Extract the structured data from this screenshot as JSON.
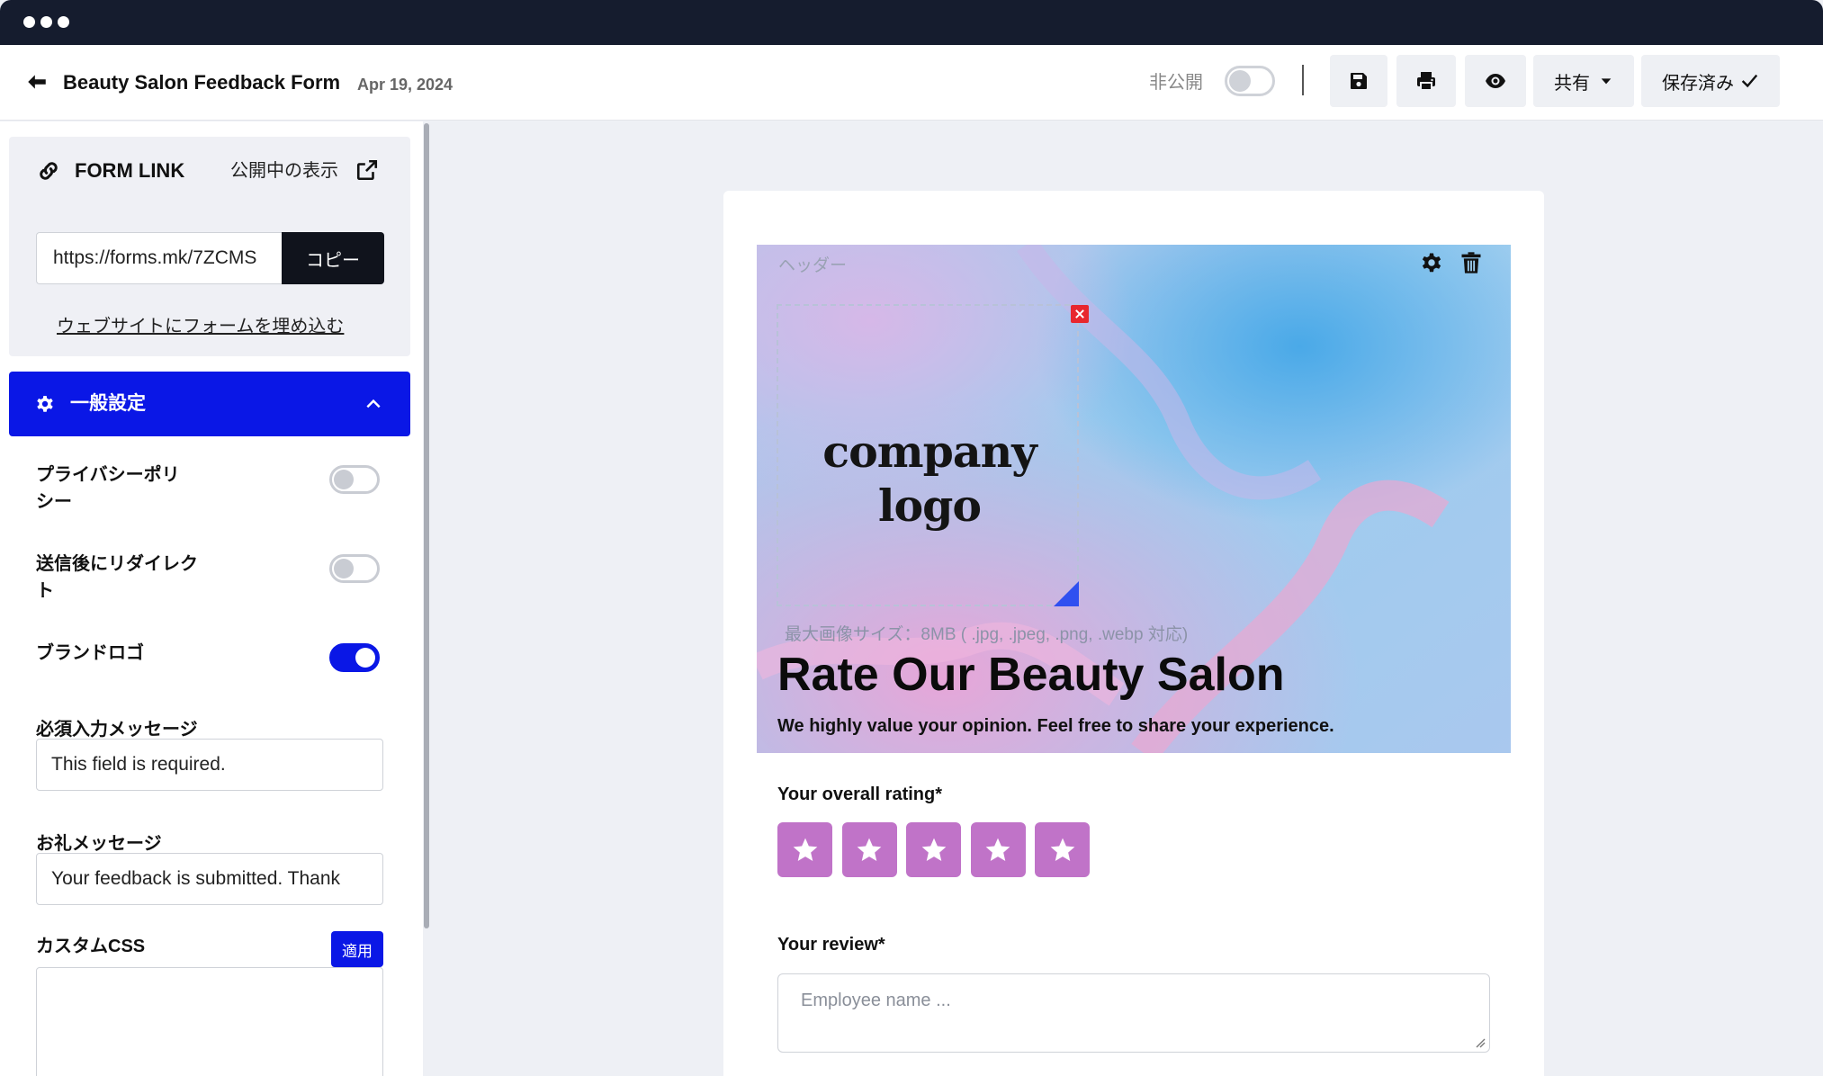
{
  "window": {
    "chrome_dots": 3
  },
  "topbar": {
    "title": "Beauty Salon Feedback Form",
    "date": "Apr 19, 2024",
    "visibility_label": "非公開",
    "visibility_on": false,
    "share_label": "共有",
    "saved_label": "保存済み"
  },
  "form_link": {
    "title": "FORM LINK",
    "public_view_label": "公開中の表示",
    "url": "https://forms.mk/7ZCMS",
    "copy_label": "コピー",
    "embed_label": "ウェブサイトにフォームを埋め込む"
  },
  "general": {
    "title": "一般設定",
    "privacy_policy_label": [
      "プライバシーポリ",
      "シー"
    ],
    "privacy_policy_on": false,
    "redirect_label": [
      "送信後にリダイレク",
      "ト"
    ],
    "redirect_on": false,
    "brand_logo_label": "ブランドロゴ",
    "brand_logo_on": true,
    "required_message_label": "必須入力メッセージ",
    "required_message_value": "This field is required.",
    "thank_you_label": "お礼メッセージ",
    "thank_you_value": "Your feedback is submitted. Thank",
    "custom_css_label": "カスタムCSS",
    "apply_label": "適用"
  },
  "canvas": {
    "header_label": "ヘッダー",
    "logo_text": "company logo",
    "size_hint": "最大画像サイズ：8MB ( .jpg, .jpeg, .png, .webp 対応)",
    "form_title": "Rate Our Beauty Salon",
    "form_subtitle": "We highly value your opinion. Feel free to share your experience.",
    "rating_label": "Your overall rating*",
    "rating_stars": 5,
    "review_label": "Your review*",
    "review_placeholder": "Employee name ..."
  },
  "colors": {
    "accent": "#0a17e6",
    "star": "#c073c8",
    "chrome": "#151c2e",
    "close": "#e8272e"
  },
  "icons": [
    "back-arrow-icon",
    "save-icon",
    "print-icon",
    "eye-icon",
    "caret-down-icon",
    "check-icon",
    "link-icon",
    "external-link-icon",
    "gear-icon",
    "chevron-up-icon",
    "trash-icon",
    "star-icon"
  ]
}
